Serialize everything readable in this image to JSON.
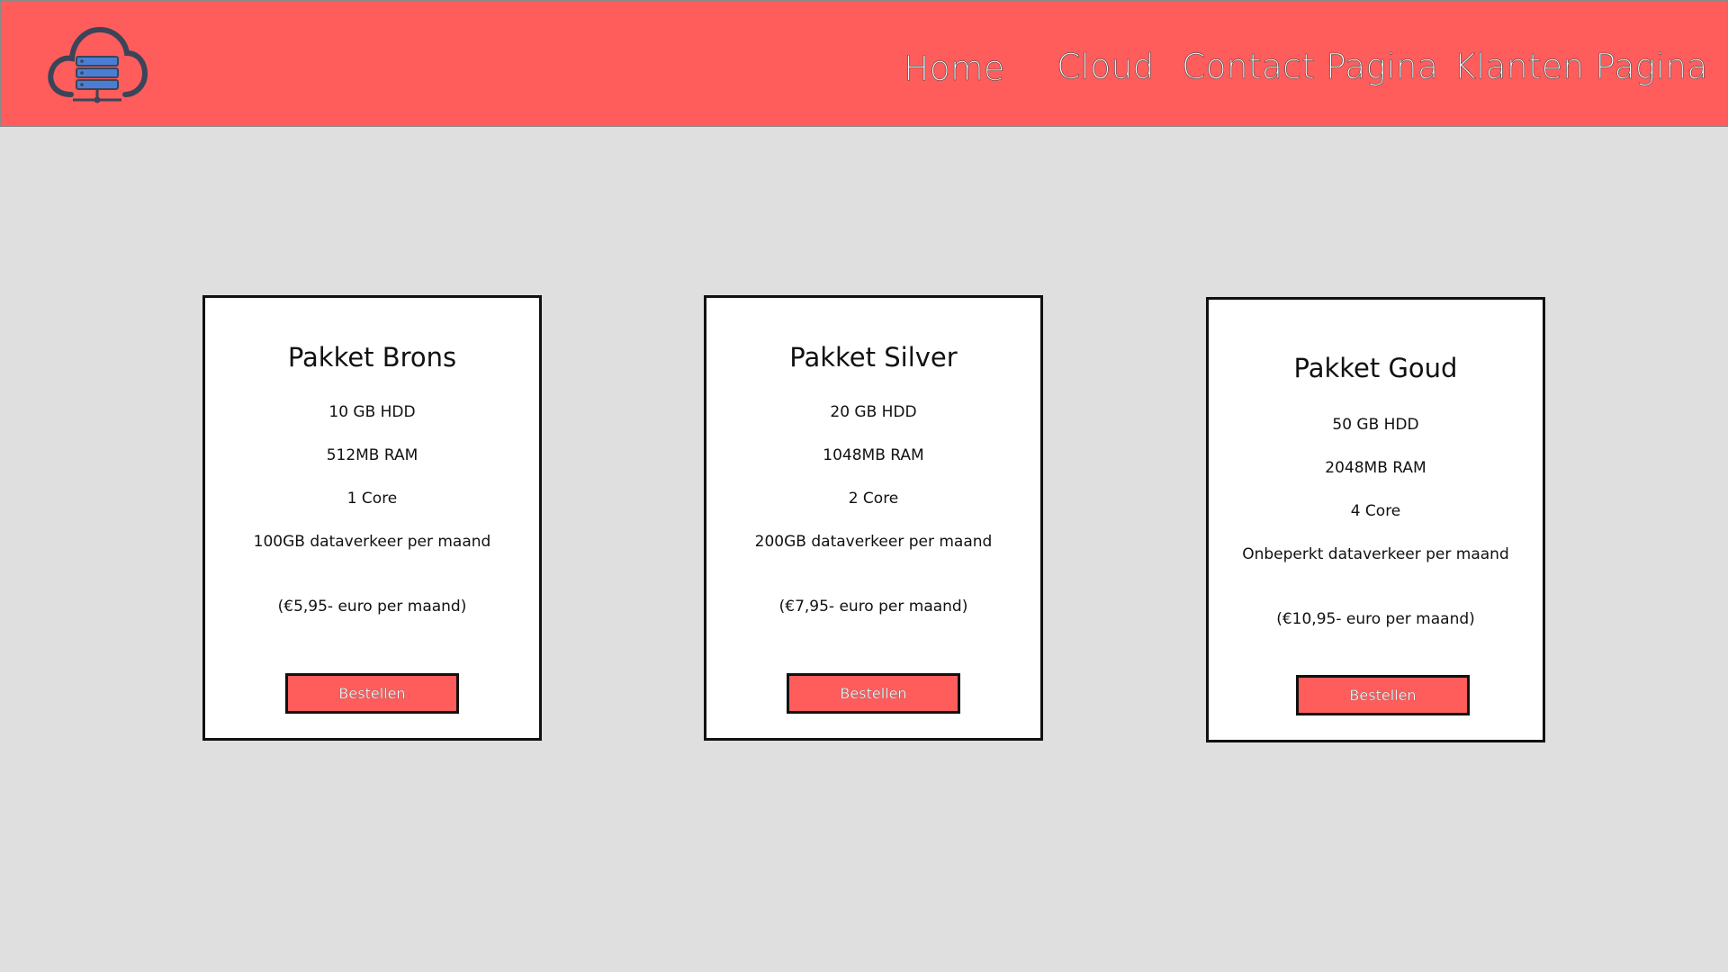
{
  "header": {
    "logo_icon": "cloud-server-icon",
    "nav": [
      {
        "label": "Home"
      },
      {
        "label": "Cloud"
      },
      {
        "label": "Contact Pagina"
      },
      {
        "label": "Klanten Pagina"
      }
    ]
  },
  "colors": {
    "accent": "#ff5c5c",
    "background": "#dfdfdf",
    "card": "#ffffff",
    "logo_dark": "#3b4459",
    "logo_blue": "#4a7ed4"
  },
  "packages": [
    {
      "title": "Pakket Brons",
      "features": [
        "10 GB HDD",
        "512MB RAM",
        "1 Core",
        "100GB dataverkeer per maand"
      ],
      "price": "(€5,95- euro per maand)",
      "button": "Bestellen"
    },
    {
      "title": "Pakket Silver",
      "features": [
        "20 GB HDD",
        "1048MB RAM",
        "2 Core",
        "200GB dataverkeer per maand"
      ],
      "price": "(€7,95- euro per maand)",
      "button": "Bestellen"
    },
    {
      "title": "Pakket Goud",
      "features": [
        "50 GB HDD",
        "2048MB RAM",
        "4 Core",
        "Onbeperkt dataverkeer per maand"
      ],
      "price": "(€10,95- euro per maand)",
      "button": "Bestellen"
    }
  ]
}
